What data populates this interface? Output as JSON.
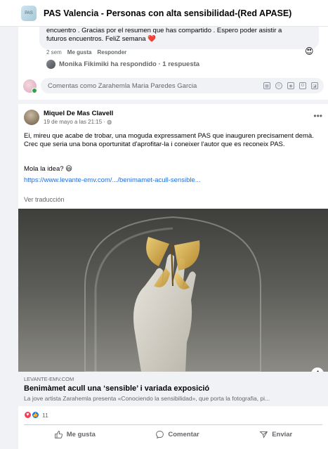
{
  "header": {
    "group_title": "PAS Valencia - Personas con alta sensibilidad-(Red APASE)",
    "group_thumb_text": "PAS"
  },
  "previous_comment": {
    "text_line1": "encuentro . Gracias por el resumen que has compartido . Espero poder asistir a",
    "text_line2": "futuros encuentros. FeliZ semana",
    "heart_emoji": "❤️",
    "time": "2 sem",
    "like_label": "Me gusta",
    "reply_label": "Responder",
    "reaction_emoji": "😍",
    "replies_text": "Monika Fikimiki ha respondido · 1 respuesta"
  },
  "composer": {
    "placeholder": "Comentas como Zarahemla Maria Paredes Garcia",
    "icons": [
      "sticker-icon",
      "emoji-icon",
      "camera-icon",
      "gif-icon",
      "sticker-alt-icon"
    ]
  },
  "post": {
    "author": "Miquel De Mas Clavell",
    "date": "19 de mayo a las 21:15 · ",
    "privacy_icon": "globe-icon",
    "text": "Ei, mireu que acabe de trobar, una moguda expressament PAS que inauguren precisament demà. Crec que seria una bona oportunitat d'aprofitar-la i coneixer l'autor que es reconeix PAS.",
    "line2": "Mola la idea? 😃",
    "link_text": "https://www.levante-emv.com/.../benimamet-acull-sensible...",
    "see_translation": "Ver traducción",
    "link_preview": {
      "domain": "LEVANTE-EMV.COM",
      "title": "Benimàmet acull una ‘sensible’ i variada exposició",
      "description": "La jove artista Zarahemla presenta «Conociendo la sensibilidad», que porta la fotografia, pi..."
    },
    "reaction_count": "11",
    "actions": {
      "like": "Me gusta",
      "comment": "Comentar",
      "send": "Enviar"
    }
  },
  "colors": {
    "link_blue": "#216fdb",
    "like_blue": "#1877f2",
    "heart_red": "#f33e58",
    "background": "#f0f2f5"
  }
}
